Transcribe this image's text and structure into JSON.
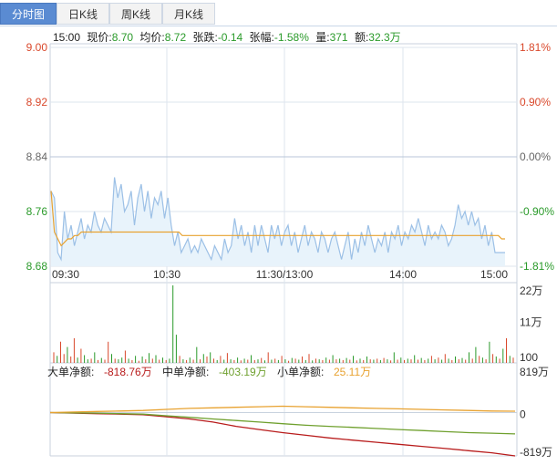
{
  "tabs": [
    {
      "label": "分时图",
      "active": true
    },
    {
      "label": "日K线",
      "active": false
    },
    {
      "label": "周K线",
      "active": false
    },
    {
      "label": "月K线",
      "active": false
    }
  ],
  "info": {
    "time": "15:00",
    "price_label": "现价:",
    "price": "8.70",
    "avg_label": "均价:",
    "avg": "8.72",
    "change_label": "张跌:",
    "change": "-0.14",
    "pct_label": "张幅:",
    "pct": "-1.58%",
    "vol_label": "量:",
    "vol": "371",
    "amt_label": "额:",
    "amt": "32.3万"
  },
  "colors": {
    "up": "#d9482b",
    "down": "#2a9a2a",
    "price_line": "#9cc0e6",
    "avg_line": "#e8a230",
    "grid": "#dde4ee",
    "big_order": "#b81c1c",
    "mid_order": "#6fa02e",
    "small_order": "#e8a230"
  },
  "chart_data": [
    {
      "type": "line",
      "name": "intraday-price",
      "x_ticks": [
        "09:30",
        "10:30",
        "11:30/13:00",
        "14:00",
        "15:00"
      ],
      "ylim": [
        8.68,
        9.0
      ],
      "y_ticks_left": [
        "9.00",
        "8.92",
        "8.84",
        "8.76",
        "8.68"
      ],
      "y_ticks_right": [
        "1.81%",
        "0.90%",
        "0.00%",
        "-0.90%",
        "-1.81%"
      ],
      "series": [
        {
          "values": [
            8.79,
            8.78,
            8.7,
            8.69,
            8.76,
            8.72,
            8.74,
            8.71,
            8.73,
            8.75,
            8.72,
            8.74,
            8.73,
            8.76,
            8.74,
            8.73,
            8.75,
            8.74,
            8.73,
            8.81,
            8.78,
            8.8,
            8.76,
            8.77,
            8.79,
            8.74,
            8.78,
            8.8,
            8.76,
            8.79,
            8.75,
            8.78,
            8.77,
            8.79,
            8.75,
            8.78,
            8.74,
            8.71,
            8.73,
            8.7,
            8.71,
            8.72,
            8.7,
            8.71,
            8.7,
            8.72,
            8.71,
            8.7,
            8.69,
            8.71,
            8.7,
            8.69,
            8.72,
            8.7,
            8.71,
            8.75,
            8.72,
            8.74,
            8.71,
            8.73,
            8.7,
            8.74,
            8.71,
            8.74,
            8.72,
            8.7,
            8.74,
            8.72,
            8.74,
            8.71,
            8.73,
            8.74,
            8.71,
            8.73,
            8.7,
            8.72,
            8.74,
            8.71,
            8.73,
            8.72,
            8.7,
            8.73,
            8.72,
            8.7,
            8.72,
            8.73,
            8.71,
            8.69,
            8.71,
            8.73,
            8.69,
            8.72,
            8.7,
            8.73,
            8.71,
            8.74,
            8.72,
            8.7,
            8.72,
            8.71,
            8.73,
            8.7,
            8.73,
            8.72,
            8.74,
            8.71,
            8.73,
            8.72,
            8.74,
            8.73,
            8.75,
            8.73,
            8.71,
            8.74,
            8.72,
            8.73,
            8.72,
            8.74,
            8.73,
            8.71,
            8.72,
            8.74,
            8.77,
            8.75,
            8.76,
            8.74,
            8.76,
            8.74,
            8.75,
            8.72,
            8.74,
            8.71,
            8.73,
            8.7,
            8.7,
            8.7,
            8.7
          ]
        },
        {
          "values": [
            8.79,
            8.73,
            8.72,
            8.71,
            8.715,
            8.72,
            8.72,
            8.725,
            8.725,
            8.73,
            8.73,
            8.73,
            8.73,
            8.73,
            8.73,
            8.73,
            8.73,
            8.73,
            8.73,
            8.73,
            8.73,
            8.73,
            8.73,
            8.73,
            8.73,
            8.73,
            8.73,
            8.73,
            8.73,
            8.73,
            8.73,
            8.73,
            8.73,
            8.73,
            8.73,
            8.73,
            8.73,
            8.73,
            8.73,
            8.725,
            8.725,
            8.725,
            8.725,
            8.725,
            8.725,
            8.725,
            8.725,
            8.725,
            8.725,
            8.725,
            8.725,
            8.725,
            8.725,
            8.725,
            8.725,
            8.725,
            8.725,
            8.725,
            8.725,
            8.725,
            8.725,
            8.725,
            8.725,
            8.725,
            8.725,
            8.725,
            8.725,
            8.725,
            8.725,
            8.725,
            8.725,
            8.725,
            8.725,
            8.725,
            8.725,
            8.725,
            8.725,
            8.725,
            8.725,
            8.725,
            8.725,
            8.725,
            8.725,
            8.725,
            8.725,
            8.725,
            8.725,
            8.725,
            8.725,
            8.725,
            8.725,
            8.725,
            8.725,
            8.725,
            8.725,
            8.725,
            8.725,
            8.725,
            8.725,
            8.725,
            8.725,
            8.725,
            8.725,
            8.725,
            8.725,
            8.725,
            8.725,
            8.725,
            8.725,
            8.725,
            8.725,
            8.725,
            8.725,
            8.725,
            8.725,
            8.725,
            8.725,
            8.725,
            8.725,
            8.725,
            8.725,
            8.725,
            8.725,
            8.725,
            8.725,
            8.725,
            8.725,
            8.725,
            8.725,
            8.725,
            8.725,
            8.725,
            8.725,
            8.725,
            8.72,
            8.72
          ]
        }
      ]
    },
    {
      "type": "bar",
      "name": "volume",
      "y_ticks": [
        "22万",
        "11万",
        "100"
      ],
      "ylim": [
        0,
        220000
      ],
      "values": [
        30000,
        20000,
        60000,
        25000,
        45000,
        18000,
        70000,
        15000,
        40000,
        22000,
        10000,
        12000,
        30000,
        8000,
        14000,
        9000,
        60000,
        25000,
        12000,
        10000,
        15000,
        35000,
        12000,
        8000,
        20000,
        6000,
        18000,
        10000,
        28000,
        12000,
        22000,
        9000,
        15000,
        8000,
        12000,
        220000,
        80000,
        20000,
        10000,
        8000,
        15000,
        9000,
        45000,
        10000,
        25000,
        18000,
        30000,
        12000,
        8000,
        20000,
        9000,
        28000,
        10000,
        8000,
        15000,
        7000,
        12000,
        9000,
        22000,
        8000,
        10000,
        14000,
        7000,
        30000,
        9000,
        12000,
        8000,
        20000,
        10000,
        6000,
        14000,
        12000,
        9000,
        18000,
        8000,
        25000,
        7000,
        12000,
        10000,
        8000,
        15000,
        9000,
        22000,
        10000,
        12000,
        8000,
        14000,
        9000,
        20000,
        7000,
        12000,
        8000,
        18000,
        10000,
        9000,
        12000,
        8000,
        14000,
        10000,
        7000,
        30000,
        9000,
        15000,
        8000,
        12000,
        10000,
        22000,
        9000,
        14000,
        8000,
        12000,
        20000,
        10000,
        15000,
        9000,
        25000,
        12000,
        8000,
        18000,
        10000,
        14000,
        9000,
        30000,
        12000,
        45000,
        20000,
        15000,
        10000,
        60000,
        25000,
        18000,
        12000,
        40000,
        70000,
        20000,
        15000
      ],
      "directions": [
        "u",
        "d",
        "u",
        "u",
        "d",
        "u",
        "u",
        "d",
        "u",
        "d",
        "d",
        "u",
        "d",
        "u",
        "d",
        "u",
        "u",
        "d",
        "u",
        "d",
        "d",
        "u",
        "d",
        "u",
        "d",
        "u",
        "d",
        "u",
        "d",
        "u",
        "d",
        "u",
        "d",
        "u",
        "d",
        "d",
        "d",
        "u",
        "d",
        "u",
        "d",
        "u",
        "d",
        "u",
        "d",
        "u",
        "d",
        "u",
        "d",
        "u",
        "d",
        "u",
        "d",
        "u",
        "d",
        "u",
        "d",
        "u",
        "d",
        "u",
        "d",
        "u",
        "d",
        "u",
        "d",
        "u",
        "d",
        "u",
        "d",
        "u",
        "d",
        "u",
        "d",
        "u",
        "d",
        "u",
        "d",
        "u",
        "d",
        "u",
        "d",
        "u",
        "d",
        "u",
        "d",
        "u",
        "d",
        "u",
        "d",
        "u",
        "d",
        "u",
        "d",
        "u",
        "d",
        "u",
        "d",
        "u",
        "d",
        "u",
        "d",
        "u",
        "d",
        "u",
        "d",
        "u",
        "d",
        "u",
        "d",
        "u",
        "d",
        "u",
        "d",
        "u",
        "d",
        "u",
        "d",
        "u",
        "d",
        "u",
        "d",
        "u",
        "d",
        "u",
        "d",
        "u",
        "d",
        "u",
        "d",
        "u",
        "d",
        "u",
        "d",
        "u",
        "d",
        "u",
        "d"
      ]
    },
    {
      "type": "line",
      "name": "order-flow",
      "y_ticks": [
        "819万",
        "0",
        "-819万"
      ],
      "ylim": [
        -819,
        819
      ],
      "legend": [
        {
          "label": "大单净额:",
          "value": "-818.76万"
        },
        {
          "label": "中单净额:",
          "value": "-403.19万"
        },
        {
          "label": "小单净额:",
          "value": "25.11万"
        }
      ],
      "series": [
        {
          "name": "大单净额",
          "values": [
            0,
            -10,
            -20,
            -30,
            -40,
            -80,
            -120,
            -180,
            -260,
            -320,
            -380,
            -430,
            -480,
            -520,
            -560,
            -600,
            -640,
            -680,
            -720,
            -760,
            -818.76
          ]
        },
        {
          "name": "中单净额",
          "values": [
            0,
            -5,
            -10,
            -20,
            -30,
            -60,
            -90,
            -120,
            -150,
            -180,
            -210,
            -240,
            -260,
            -280,
            -300,
            -320,
            -340,
            -360,
            -380,
            -390,
            -403.19
          ]
        },
        {
          "name": "小单净额",
          "values": [
            0,
            10,
            20,
            30,
            40,
            60,
            80,
            90,
            100,
            110,
            120,
            110,
            100,
            90,
            80,
            70,
            60,
            50,
            40,
            30,
            25.11
          ]
        }
      ]
    }
  ]
}
